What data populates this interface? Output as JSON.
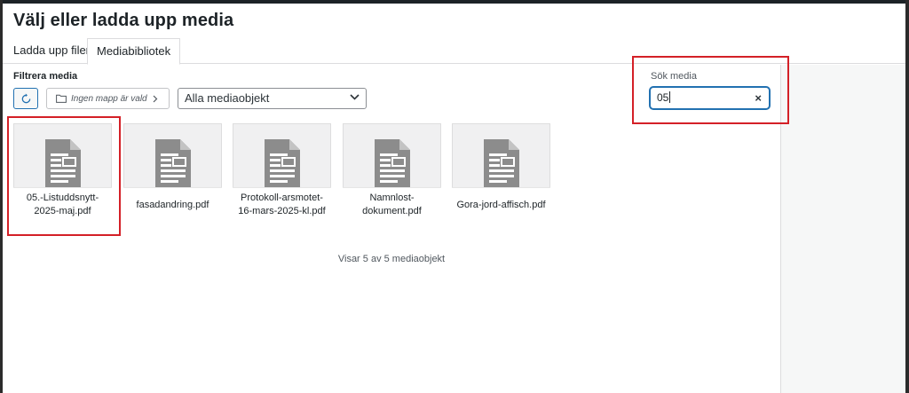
{
  "modal": {
    "title": "Välj eller ladda upp media"
  },
  "tabs": [
    {
      "label": "Ladda upp filer"
    },
    {
      "label": "Mediabibliotek"
    }
  ],
  "filters": {
    "label": "Filtrera media",
    "folder_label": "Ingen mapp är vald",
    "type_select_value": "Alla mediaobjekt"
  },
  "search": {
    "label": "Sök media",
    "value": "05"
  },
  "media_items": [
    {
      "filename": "05.-Listuddsnytt-2025-maj.pdf"
    },
    {
      "filename": "fasadandring.pdf"
    },
    {
      "filename": "Protokoll-arsmotet-16-mars-2025-kl.pdf"
    },
    {
      "filename": "Namnlost-dokument.pdf"
    },
    {
      "filename": "Gora-jord-affisch.pdf"
    }
  ],
  "status": {
    "count_text": "Visar 5 av 5 mediaobjekt"
  },
  "icons": {
    "refresh": "refresh-icon",
    "folder": "folder-icon",
    "chevron_right": "chevron-right-icon",
    "chevron_down": "chevron-down-icon",
    "clear": "clear-icon",
    "document": "document-icon"
  },
  "colors": {
    "accent": "#2271b1",
    "highlight": "#d42027",
    "thumb_bg": "#f0f0f1",
    "doc_icon": "#8c8c8c"
  }
}
